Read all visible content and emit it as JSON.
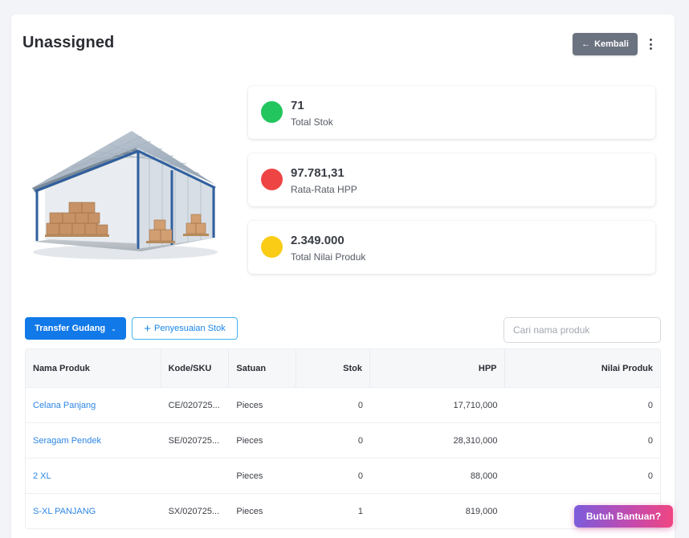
{
  "header": {
    "title": "Unassigned",
    "back_label": "Kembali",
    "back_icon": "arrow-left-icon",
    "more_icon": "kebab-menu-icon"
  },
  "stats": [
    {
      "value": "71",
      "label": "Total Stok",
      "color": "#22c55e"
    },
    {
      "value": "97.781,31",
      "label": "Rata-Rata HPP",
      "color": "#ef4444"
    },
    {
      "value": "2.349.000",
      "label": "Total Nilai Produk",
      "color": "#facc15"
    }
  ],
  "toolbar": {
    "transfer_label": "Transfer Gudang",
    "adjust_label": "Penyesuaian Stok",
    "search_placeholder": "Cari nama produk"
  },
  "table": {
    "columns": [
      "Nama Produk",
      "Kode/SKU",
      "Satuan",
      "Stok",
      "HPP",
      "Nilai Produk"
    ],
    "rows": [
      {
        "name": "Celana Panjang",
        "sku": "CE/020725...",
        "unit": "Pieces",
        "stock": "0",
        "hpp": "17,710,000",
        "value": "0"
      },
      {
        "name": "Seragam Pendek",
        "sku": "SE/020725...",
        "unit": "Pieces",
        "stock": "0",
        "hpp": "28,310,000",
        "value": "0"
      },
      {
        "name": "2 XL",
        "sku": "",
        "unit": "Pieces",
        "stock": "0",
        "hpp": "88,000",
        "value": "0"
      },
      {
        "name": "S-XL PANJANG",
        "sku": "SX/020725...",
        "unit": "Pieces",
        "stock": "1",
        "hpp": "819,000",
        "value": ""
      }
    ]
  },
  "help_button": {
    "label": "Butuh Bantuan?"
  }
}
